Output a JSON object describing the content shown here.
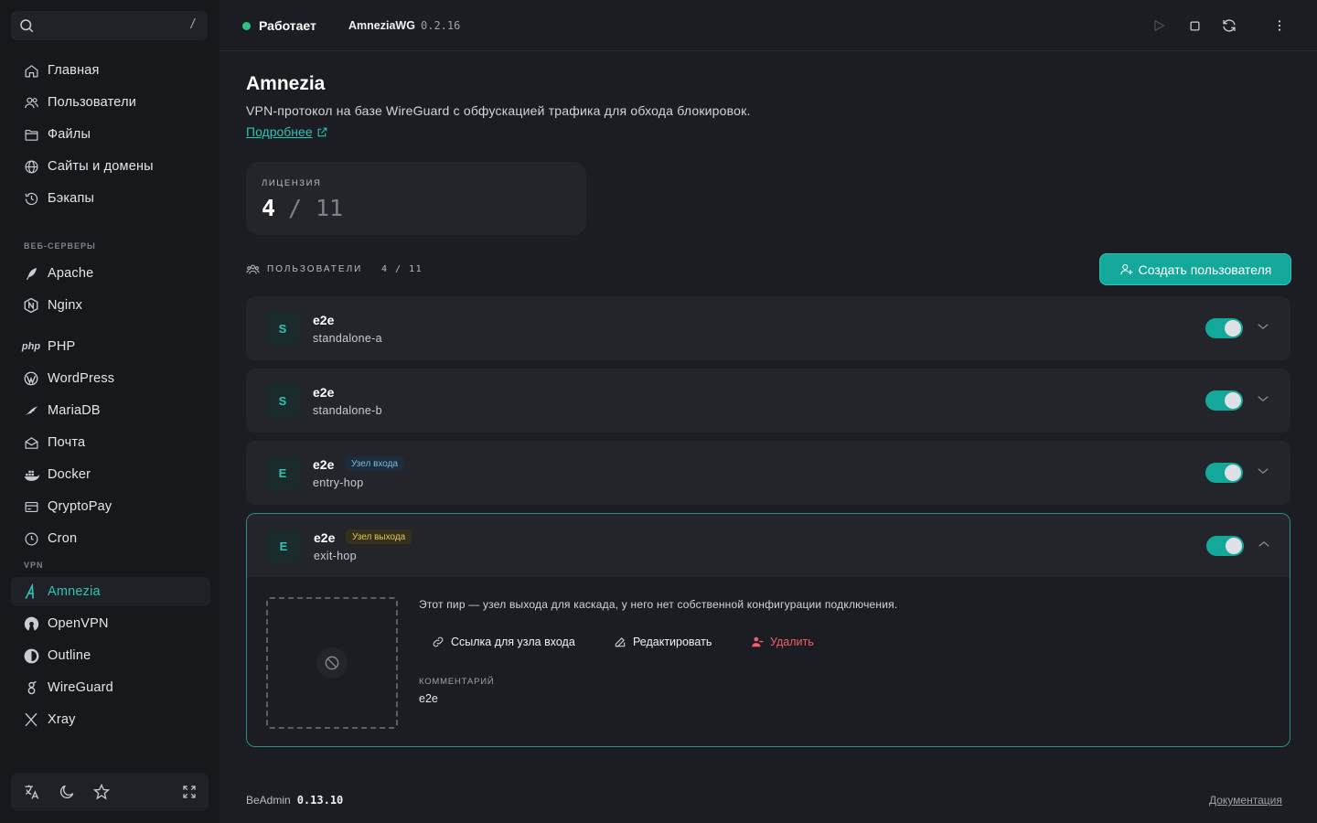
{
  "search": {
    "shortcut": "/"
  },
  "sidebar": {
    "items": [
      {
        "label": "Главная",
        "icon": "home-icon"
      },
      {
        "label": "Пользователи",
        "icon": "users-icon"
      },
      {
        "label": "Файлы",
        "icon": "folder-icon"
      },
      {
        "label": "Сайты и домены",
        "icon": "globe-icon"
      },
      {
        "label": "Бэкапы",
        "icon": "history-icon"
      }
    ],
    "web_section": "ВЕБ-СЕРВЕРЫ",
    "web_items": [
      {
        "label": "Apache",
        "icon": "feather-icon"
      },
      {
        "label": "Nginx",
        "icon": "nginx-icon"
      }
    ],
    "other_items": [
      {
        "label": "PHP",
        "icon": "php-icon",
        "icon_text": "php"
      },
      {
        "label": "WordPress",
        "icon": "wordpress-icon"
      },
      {
        "label": "MariaDB",
        "icon": "seal-icon"
      },
      {
        "label": "Почта",
        "icon": "mail-icon"
      },
      {
        "label": "Docker",
        "icon": "docker-icon"
      },
      {
        "label": "QryptoPay",
        "icon": "card-icon"
      },
      {
        "label": "Cron",
        "icon": "clock-icon"
      }
    ],
    "vpn_section": "VPN",
    "vpn_items": [
      {
        "label": "Amnezia",
        "icon": "amnezia-icon",
        "active": true
      },
      {
        "label": "OpenVPN",
        "icon": "openvpn-icon"
      },
      {
        "label": "Outline",
        "icon": "outline-icon"
      },
      {
        "label": "WireGuard",
        "icon": "wireguard-icon"
      },
      {
        "label": "Xray",
        "icon": "xray-icon"
      }
    ]
  },
  "topbar": {
    "status": "Работает",
    "status_color": "#2ec27e",
    "app_name": "AmneziaWG",
    "app_version": "0.2.16"
  },
  "page": {
    "title": "Amnezia",
    "description": "VPN-протокол на базе WireGuard с обфускацией трафика для обхода блокировок.",
    "more_link": "Подробнее"
  },
  "license": {
    "caption": "ЛИЦЕНЗИЯ",
    "used": "4",
    "separator": "/",
    "total": "11"
  },
  "users_header": {
    "label": "ПОЛЬЗОВАТЕЛИ",
    "count": "4 / 11",
    "create_button": "Создать пользователя"
  },
  "users": [
    {
      "initial": "S",
      "name": "e2e",
      "sub": "standalone-a",
      "badge": "",
      "enabled": true
    },
    {
      "initial": "S",
      "name": "e2e",
      "sub": "standalone-b",
      "badge": "",
      "enabled": true
    },
    {
      "initial": "E",
      "name": "e2e",
      "sub": "entry-hop",
      "badge": "Узел входа",
      "enabled": true
    },
    {
      "initial": "E",
      "name": "e2e",
      "sub": "exit-hop",
      "badge": "Узел выхода",
      "enabled": true,
      "expanded": true
    }
  ],
  "expanded": {
    "peer_text": "Этот пир — узел выхода для каскада, у него нет собственной конфигурации подключения.",
    "link_action": "Ссылка для узла входа",
    "edit_action": "Редактировать",
    "delete_action": "Удалить",
    "comment_caption": "КОММЕНТАРИЙ",
    "comment_value": "e2e"
  },
  "footer": {
    "product": "BeAdmin",
    "version": "0.13.10",
    "docs": "Документация"
  },
  "colors": {
    "accent": "#2ec4b6",
    "danger": "#ef5f6c",
    "badge_in": "#7dbbe6",
    "badge_out": "#e7c456"
  }
}
